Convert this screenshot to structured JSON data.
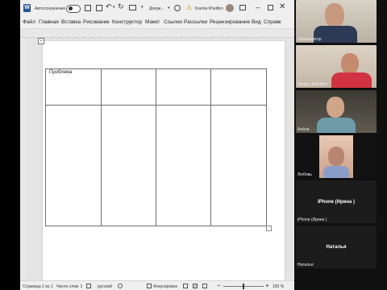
{
  "word": {
    "autosave_label": "Автосохранение",
    "file_name": "Докум...",
    "user_name": "Ksenia Kheilton",
    "menu": [
      "Файл",
      "Главная",
      "Вставка",
      "Рисование",
      "Конструктор",
      "Макет",
      "Ссылки",
      "Рассылки",
      "Рецензирование",
      "Вид",
      "Справк"
    ],
    "table": {
      "first_cell_text": "Проблема"
    },
    "status": {
      "page": "Страница 1 из 1",
      "words": "Число слов: 1",
      "language": "русский",
      "focus": "Фокусировка",
      "zoom": "100 %"
    }
  },
  "participants": [
    {
      "name": "Организатор"
    },
    {
      "name": "Sergey Sheriftan"
    },
    {
      "name": "Алёна"
    },
    {
      "name": "Любовь"
    },
    {
      "name": "iPhone (Ирина )",
      "display": "iPhone (Ирина )"
    },
    {
      "name": "Наталья",
      "display": "Наталья"
    }
  ]
}
